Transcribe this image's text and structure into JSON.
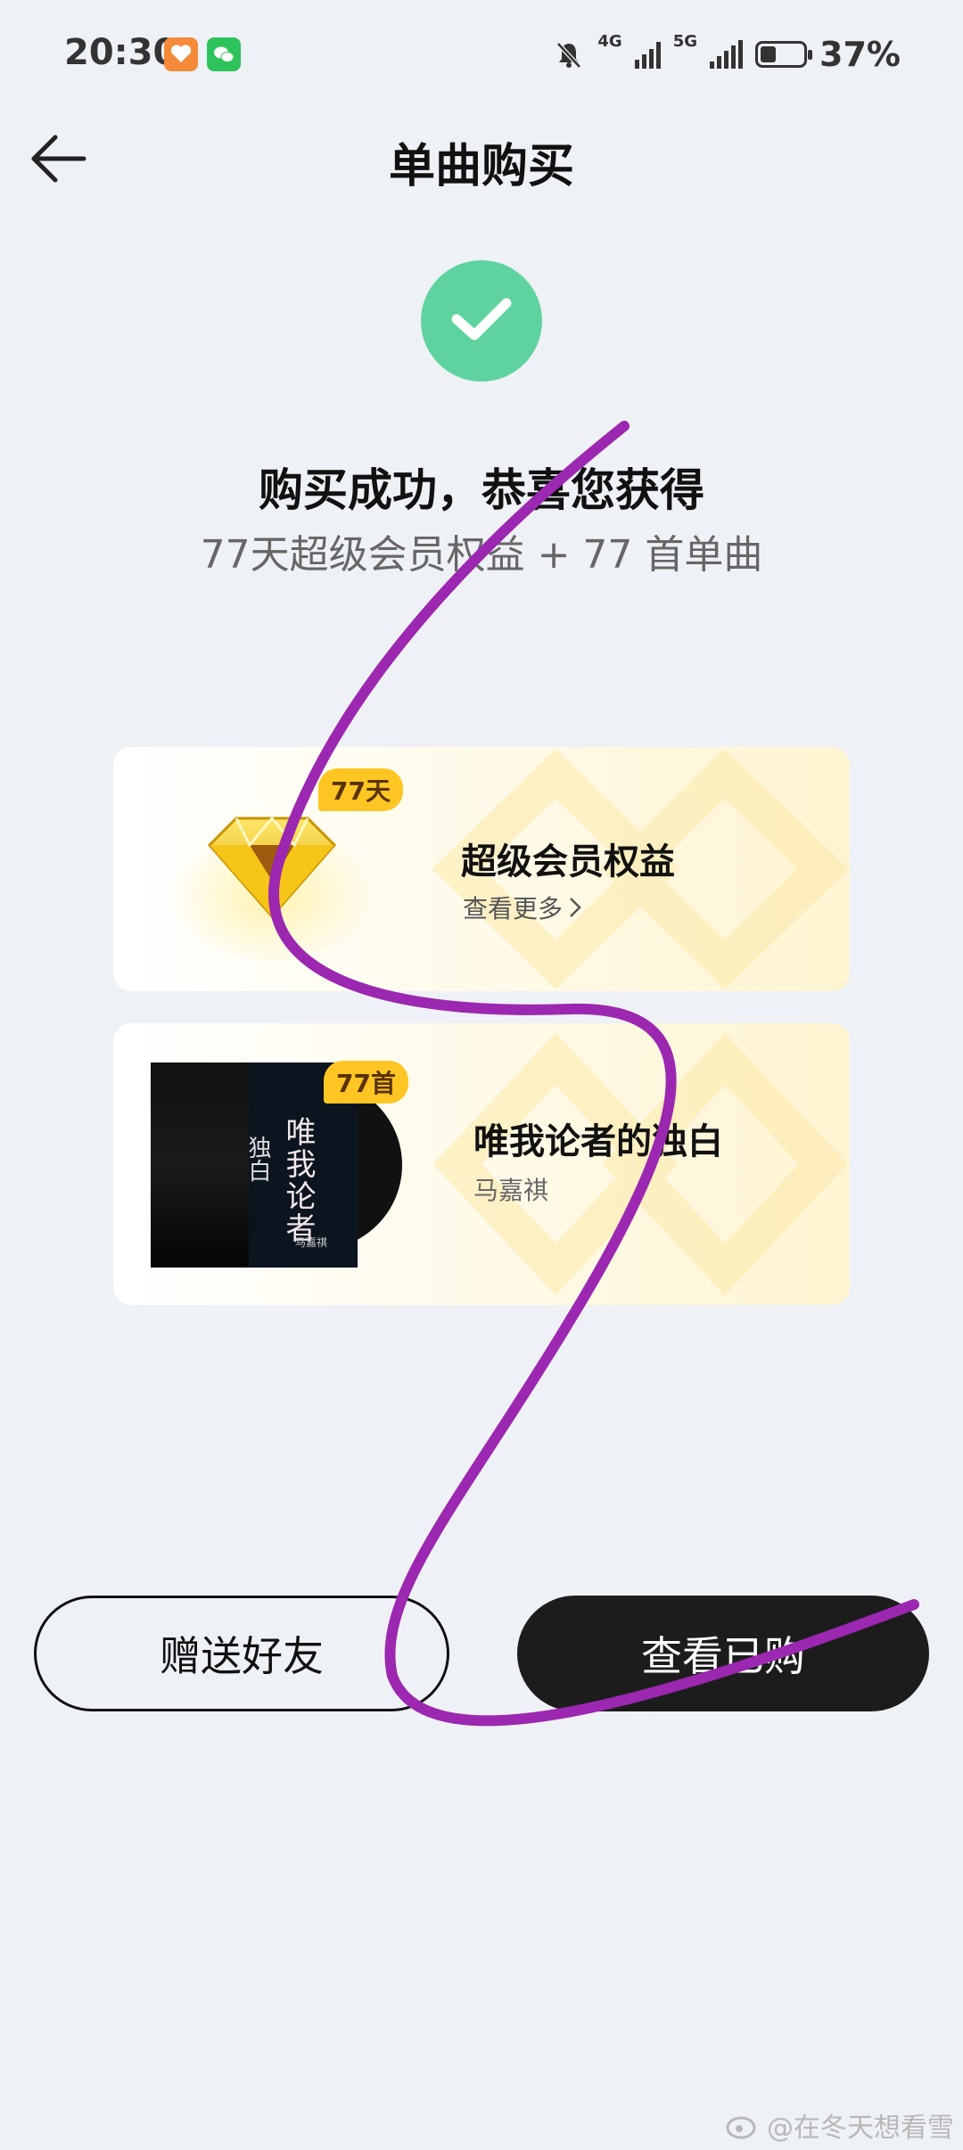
{
  "status_bar": {
    "time": "20:30",
    "network_1": "4G",
    "network_2": "5G",
    "battery_percent": "37%",
    "battery_level": 0.37,
    "icons": [
      "heart-app-icon",
      "wechat-icon",
      "mute-icon",
      "signal-icon",
      "battery-icon"
    ]
  },
  "header": {
    "title": "单曲购买",
    "back_icon": "arrow-left-icon"
  },
  "success": {
    "icon": "check-icon",
    "title": "购买成功，恭喜您获得",
    "subtitle": "77天超级会员权益 + 77 首单曲"
  },
  "vip_card": {
    "tag": "77天",
    "title": "超级会员权益",
    "more_label": "查看更多"
  },
  "song_card": {
    "tag": "77首",
    "title": "唯我论者的独白",
    "artist": "马嘉祺",
    "album_text": "唯我论者",
    "album_sub": "独白",
    "album_artist": "马嘉祺"
  },
  "buttons": {
    "gift": "赠送好友",
    "view": "查看已购"
  },
  "watermark": "@在冬天想看雪",
  "colors": {
    "success": "#5fd39f",
    "tag": "#ffc623",
    "primary_button": "#1c1c1c",
    "scribble": "#9c27b0"
  }
}
